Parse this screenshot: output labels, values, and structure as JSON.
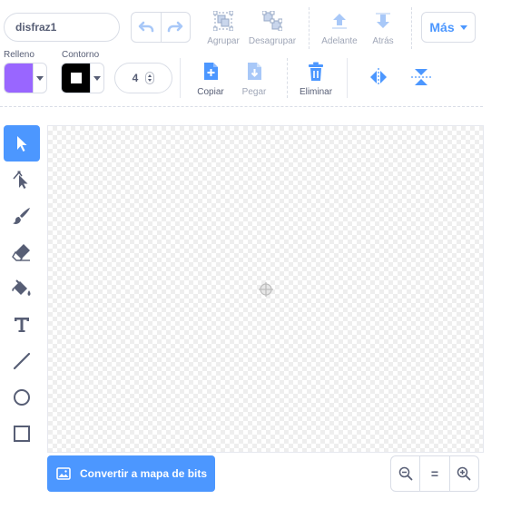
{
  "costume": {
    "name": "disfraz1"
  },
  "toolbar_top": {
    "group_label": "Agrupar",
    "ungroup_label": "Desagrupar",
    "forward_label": "Adelante",
    "backward_label": "Atrás",
    "more_label": "Más"
  },
  "toolbar_props": {
    "fill_label": "Relleno",
    "fill_color": "#9966ff",
    "outline_label": "Contorno",
    "outline_color": "#000000",
    "outline_width": "4",
    "copy_label": "Copiar",
    "paste_label": "Pegar",
    "delete_label": "Eliminar"
  },
  "tools": [
    {
      "name": "select",
      "icon": "select-arrow-icon",
      "selected": true
    },
    {
      "name": "reshape",
      "icon": "reshape-icon"
    },
    {
      "name": "brush",
      "icon": "brush-icon"
    },
    {
      "name": "eraser",
      "icon": "eraser-icon"
    },
    {
      "name": "fill",
      "icon": "fill-bucket-icon"
    },
    {
      "name": "text",
      "icon": "text-icon"
    },
    {
      "name": "line",
      "icon": "line-icon"
    },
    {
      "name": "circle",
      "icon": "circle-icon"
    },
    {
      "name": "rectangle",
      "icon": "rectangle-icon"
    }
  ],
  "footer": {
    "convert_label": "Convertir a mapa de bits",
    "zoom_reset_label": "="
  },
  "colors": {
    "accent": "#4c97ff",
    "text": "#575e75",
    "disabled": "#9fa6b7"
  }
}
